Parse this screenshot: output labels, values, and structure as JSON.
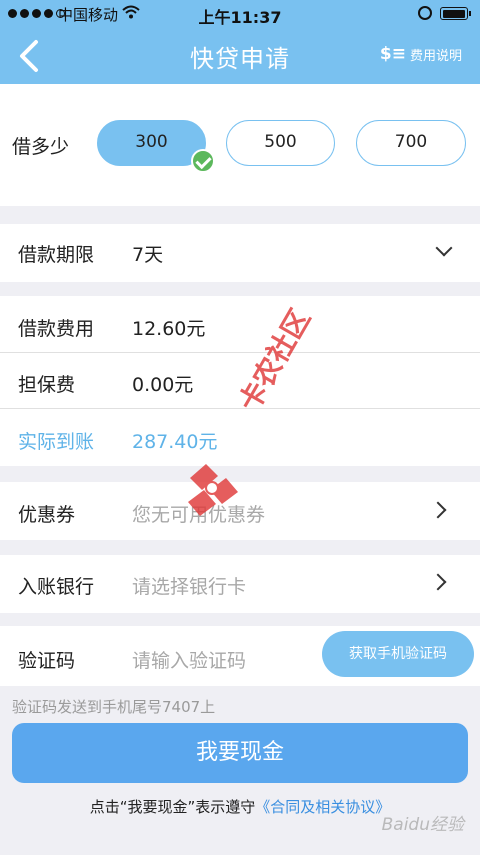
{
  "status_bar": {
    "carrier": "中国移动",
    "time": "上午11:37"
  },
  "nav": {
    "title": "快贷申请",
    "fee_icon": "$≡",
    "fee_label": "费用说明"
  },
  "amount": {
    "label": "借多少",
    "options": [
      "300",
      "500",
      "700"
    ],
    "selected": "300"
  },
  "term": {
    "label": "借款期限",
    "value": "7天"
  },
  "fee": {
    "label": "借款费用",
    "value": "12.60元"
  },
  "guarantee": {
    "label": "担保费",
    "value": "0.00元"
  },
  "actual": {
    "label": "实际到账",
    "value": "287.40元",
    "color": "#5fb3e8"
  },
  "coupon": {
    "label": "优惠券",
    "placeholder": "您无可用优惠券"
  },
  "bank": {
    "label": "入账银行",
    "placeholder": "请选择银行卡"
  },
  "verify": {
    "label": "验证码",
    "placeholder": "请输入验证码",
    "button": "获取手机验证码"
  },
  "hint": "验证码发送到手机尾号7407上",
  "submit": "我要现金",
  "agreement": {
    "prefix": "点击“我要现金”表示遵守",
    "link": "《合同及相关协议》"
  },
  "watermark": {
    "text": "卡农社区",
    "logo": "Baidu经验"
  },
  "colors": {
    "primary": "#79c1f0",
    "submit": "#5aa7ee",
    "check": "#5cb85c",
    "link": "#3a8fe0"
  }
}
